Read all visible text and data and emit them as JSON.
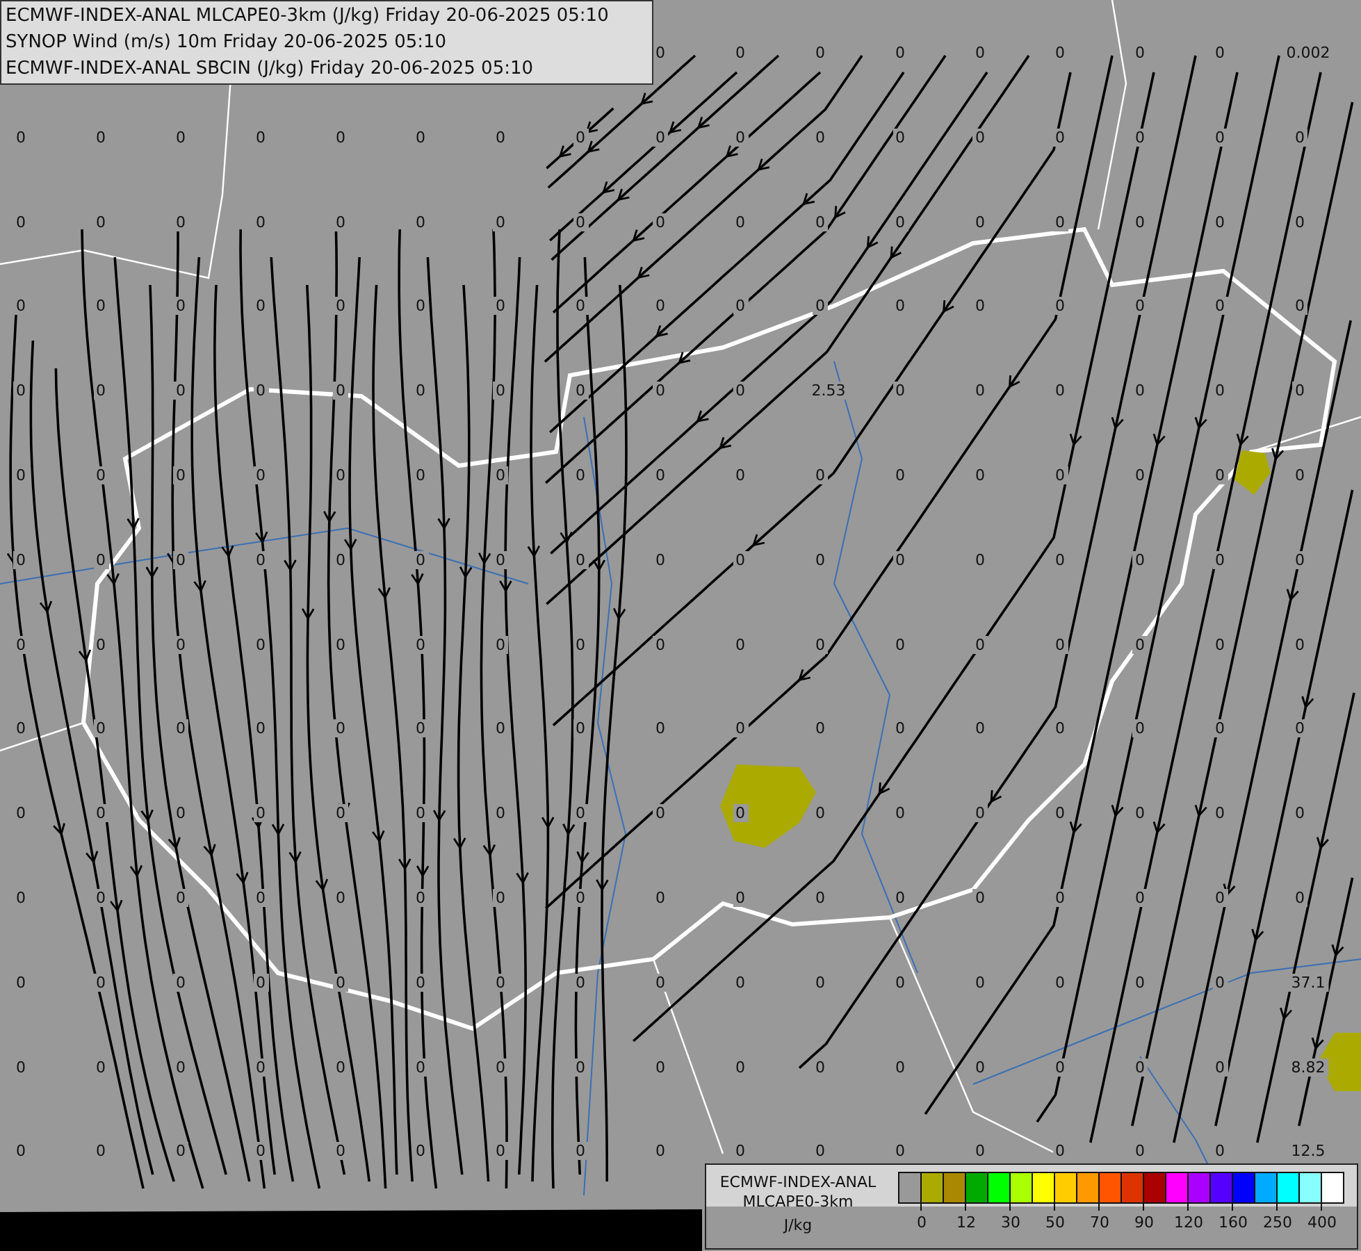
{
  "title_box": {
    "lines": [
      "ECMWF-INDEX-ANAL MLCAPE0-3km (J/kg) Friday 20-06-2025 05:10",
      "SYNOP Wind (m/s) 10m Friday 20-06-2025 05:10",
      "ECMWF-INDEX-ANAL SBCIN (J/kg) Friday 20-06-2025 05:10"
    ]
  },
  "grid_values": [
    [
      "0",
      "0",
      "0",
      "0",
      "0",
      "0",
      "0",
      "0",
      "0.002"
    ],
    [
      "0",
      "0",
      "0",
      "0",
      "0",
      "0",
      "0",
      "0",
      "0",
      "0",
      "0",
      "0",
      "0",
      "0",
      "0",
      "0",
      "0"
    ],
    [
      "0",
      "0",
      "0",
      "0",
      "0",
      "0",
      "0",
      "0",
      "0",
      "0",
      "0",
      "0",
      "0",
      "0",
      "0",
      "0",
      "0"
    ],
    [
      "0",
      "0",
      "0",
      "0",
      "0",
      "0",
      "0",
      "0",
      "0",
      "0",
      "0",
      "0",
      "0",
      "0",
      "0",
      "0",
      "0"
    ],
    [
      "0",
      "0",
      "0",
      "0",
      "0",
      "0",
      "0",
      "0",
      "0",
      "0",
      "2.53",
      "0",
      "0",
      "0",
      "0",
      "0",
      "0"
    ],
    [
      "0",
      "0",
      "0",
      "0",
      "0",
      "0",
      "0",
      "0",
      "0",
      "0",
      "0",
      "0",
      "0",
      "0",
      "0",
      "0",
      "0"
    ],
    [
      "0",
      "0",
      "0",
      "0",
      "0",
      "0",
      "0",
      "0",
      "0",
      "0",
      "0",
      "0",
      "0",
      "0",
      "0",
      "0",
      "0"
    ],
    [
      "0",
      "0",
      "0",
      "0",
      "0",
      "0",
      "0",
      "0",
      "0",
      "0",
      "0",
      "0",
      "0",
      "0",
      "0",
      "0",
      "0"
    ],
    [
      "0",
      "0",
      "0",
      "0",
      "0",
      "0",
      "0",
      "0",
      "0",
      "0",
      "0",
      "0",
      "0",
      "0",
      "0",
      "0",
      "0"
    ],
    [
      "0",
      "0",
      "0",
      "0",
      "0",
      "0",
      "0",
      "0",
      "0",
      "0",
      "0",
      "0",
      "0",
      "0",
      "0",
      "0",
      "0"
    ],
    [
      "0",
      "0",
      "0",
      "0",
      "0",
      "0",
      "0",
      "0",
      "0",
      "0",
      "0",
      "0",
      "0",
      "0",
      "0",
      "0",
      "0"
    ],
    [
      "0",
      "0",
      "0",
      "0",
      "0",
      "0",
      "0",
      "0",
      "0",
      "0",
      "0",
      "0",
      "0",
      "0",
      "0",
      "0",
      "37.1"
    ],
    [
      "0",
      "0",
      "0",
      "0",
      "0",
      "0",
      "0",
      "0",
      "0",
      "0",
      "0",
      "0",
      "0",
      "0",
      "0",
      "0",
      "8.82"
    ],
    [
      "0",
      "0",
      "0",
      "0",
      "0",
      "0",
      "0",
      "0",
      "0",
      "0",
      "0",
      "0",
      "0",
      "0",
      "0",
      "0",
      "12.5"
    ]
  ],
  "legend": {
    "lines": [
      "ECMWF-INDEX-ANAL",
      "MLCAPE0-3km"
    ],
    "unit": "J/kg",
    "swatches": [
      {
        "color": "#999999"
      },
      {
        "color": "#aaaa00"
      },
      {
        "color": "#aa8800"
      },
      {
        "color": "#00aa00"
      },
      {
        "color": "#00ff00"
      },
      {
        "color": "#aaff00"
      },
      {
        "color": "#ffff00"
      },
      {
        "color": "#ffcc00"
      },
      {
        "color": "#ff9900"
      },
      {
        "color": "#ff5500"
      },
      {
        "color": "#dd3300"
      },
      {
        "color": "#aa0000"
      },
      {
        "color": "#ff00ff"
      },
      {
        "color": "#aa00ff"
      },
      {
        "color": "#5500ff"
      },
      {
        "color": "#0000ff"
      },
      {
        "color": "#00aaff"
      },
      {
        "color": "#00ffff"
      },
      {
        "color": "#88ffff"
      },
      {
        "color": "#ffffff"
      }
    ],
    "ticks": [
      "0",
      "12",
      "30",
      "50",
      "70",
      "90",
      "120",
      "160",
      "250",
      "400"
    ]
  }
}
